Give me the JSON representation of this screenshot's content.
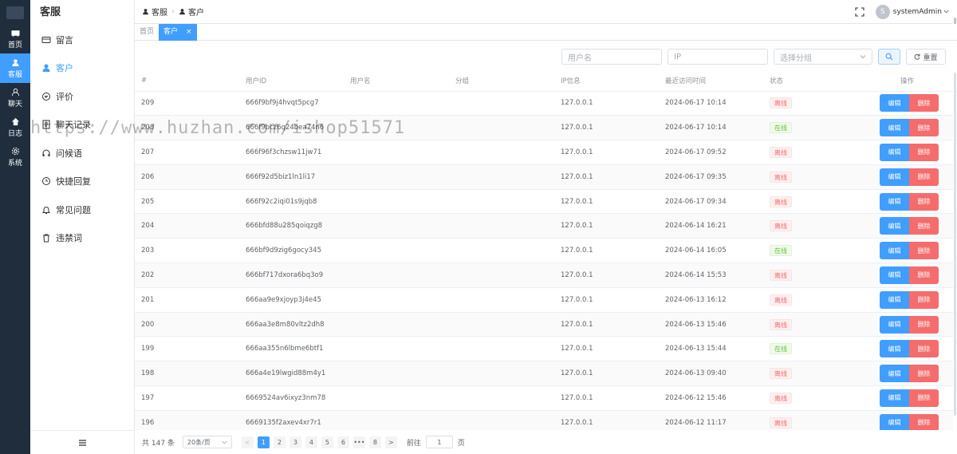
{
  "rail": {
    "items": [
      {
        "label": "首页",
        "icon": "dashboard-icon"
      },
      {
        "label": "客服",
        "icon": "user-icon"
      },
      {
        "label": "聊天",
        "icon": "chat-user-icon"
      },
      {
        "label": "日志",
        "icon": "home-icon"
      },
      {
        "label": "系统",
        "icon": "gear-icon"
      }
    ]
  },
  "side": {
    "title": "客服",
    "items": [
      {
        "label": "留言",
        "icon": "card-icon"
      },
      {
        "label": "客户",
        "icon": "user-icon"
      },
      {
        "label": "评价",
        "icon": "comment-icon"
      },
      {
        "label": "聊天记录",
        "icon": "document-icon"
      },
      {
        "label": "问候语",
        "icon": "headset-icon"
      },
      {
        "label": "快捷回复",
        "icon": "clock-icon"
      },
      {
        "label": "常见问题",
        "icon": "bell-icon"
      },
      {
        "label": "违禁词",
        "icon": "trash-icon"
      }
    ]
  },
  "header": {
    "crumb1": "客服",
    "crumb2": "客户",
    "avatar": "S",
    "username": "systemAdmin"
  },
  "tags": {
    "home": "首页",
    "current": "客户",
    "close": "×"
  },
  "filters": {
    "username_placeholder": "用户名",
    "ip_placeholder": "IP",
    "group_placeholder": "选择分组",
    "reset": "重置"
  },
  "table": {
    "headers": [
      "#",
      "用户ID",
      "用户名",
      "分组",
      "IP信息",
      "最近访问时间",
      "状态",
      "操作"
    ],
    "edit_label": "编辑",
    "delete_label": "删除",
    "rows": [
      {
        "id": "209",
        "uid": "666f9bf9j4hvqt5pcg7",
        "ip": "127.0.0.1",
        "time": "2024-06-17 10:14",
        "status": "离线",
        "online": false
      },
      {
        "id": "208",
        "uid": "666f9bcz6q24bea74n6",
        "ip": "127.0.0.1",
        "time": "2024-06-17 10:14",
        "status": "在线",
        "online": true
      },
      {
        "id": "207",
        "uid": "666f96f3chzsw11jw71",
        "ip": "127.0.0.1",
        "time": "2024-06-17 09:52",
        "status": "离线",
        "online": false
      },
      {
        "id": "206",
        "uid": "666f92d5biz1ln1li17",
        "ip": "127.0.0.1",
        "time": "2024-06-17 09:35",
        "status": "离线",
        "online": false
      },
      {
        "id": "205",
        "uid": "666f92c2iqi01s9jqb8",
        "ip": "127.0.0.1",
        "time": "2024-06-17 09:34",
        "status": "离线",
        "online": false
      },
      {
        "id": "204",
        "uid": "666bfd88u285qoiqzg8",
        "ip": "127.0.0.1",
        "time": "2024-06-14 16:21",
        "status": "离线",
        "online": false
      },
      {
        "id": "203",
        "uid": "666bf9d9zig6gocy345",
        "ip": "127.0.0.1",
        "time": "2024-06-14 16:05",
        "status": "在线",
        "online": true
      },
      {
        "id": "202",
        "uid": "666bf717dxora6bq3o9",
        "ip": "127.0.0.1",
        "time": "2024-06-14 15:53",
        "status": "离线",
        "online": false
      },
      {
        "id": "201",
        "uid": "666aa9e9xjoyp3j4e45",
        "ip": "127.0.0.1",
        "time": "2024-06-13 16:12",
        "status": "离线",
        "online": false
      },
      {
        "id": "200",
        "uid": "666aa3e8m80vltz2dh8",
        "ip": "127.0.0.1",
        "time": "2024-06-13 15:46",
        "status": "离线",
        "online": false
      },
      {
        "id": "199",
        "uid": "666aa355n6lbme6btf1",
        "ip": "127.0.0.1",
        "time": "2024-06-13 15:44",
        "status": "在线",
        "online": true
      },
      {
        "id": "198",
        "uid": "666a4e19lwgid88m4y1",
        "ip": "127.0.0.1",
        "time": "2024-06-13 09:40",
        "status": "离线",
        "online": false
      },
      {
        "id": "197",
        "uid": "6669524av6ixyz3nm78",
        "ip": "127.0.0.1",
        "time": "2024-06-12 15:46",
        "status": "离线",
        "online": false
      },
      {
        "id": "196",
        "uid": "6669135f2axev4xr7r1",
        "ip": "127.0.0.1",
        "time": "2024-06-12 11:17",
        "status": "离线",
        "online": false
      }
    ]
  },
  "pager": {
    "total": "共 147 条",
    "size": "20条/页",
    "pages": [
      "1",
      "2",
      "3",
      "4",
      "5",
      "6",
      "•••",
      "8"
    ],
    "prev": "<",
    "next": ">",
    "goto": "前往",
    "jump_value": "1",
    "page_unit": "页"
  },
  "watermark": "https://www.huzhan.com/ishop51571",
  "colors": {
    "primary": "#409eff",
    "danger": "#f56c6c",
    "success": "#67c23a",
    "rail_bg": "#1f2d3d"
  }
}
